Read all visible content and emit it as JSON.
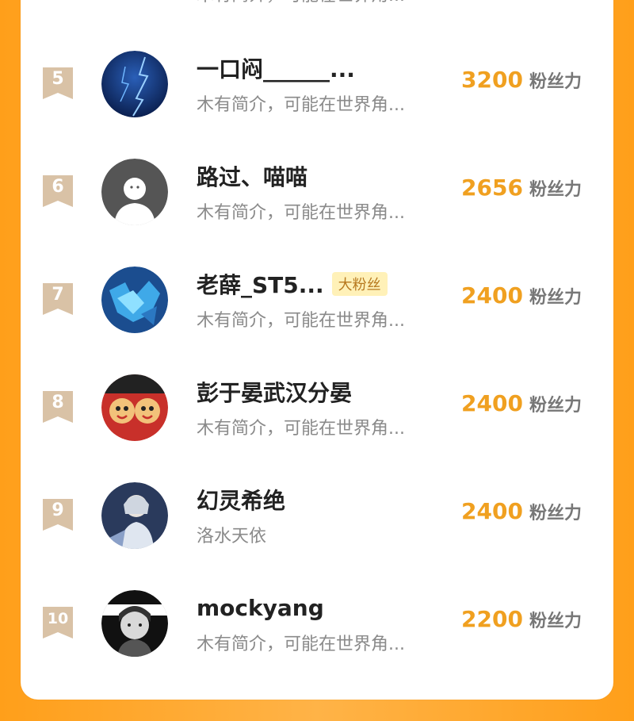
{
  "top_partial": {
    "intro": "木有简介，可能在世界角..."
  },
  "score_unit": "粉丝力",
  "rows": [
    {
      "rank": "5",
      "name": "一口闷______...",
      "intro": "木有简介，可能在世界角...",
      "score": "3200",
      "badge": ""
    },
    {
      "rank": "6",
      "name": "路过、喵喵",
      "intro": "木有简介，可能在世界角...",
      "score": "2656",
      "badge": ""
    },
    {
      "rank": "7",
      "name": "老薛_ST5...",
      "intro": "木有简介，可能在世界角...",
      "score": "2400",
      "badge": "大粉丝"
    },
    {
      "rank": "8",
      "name": "彭于晏武汉分晏",
      "intro": "木有简介，可能在世界角...",
      "score": "2400",
      "badge": ""
    },
    {
      "rank": "9",
      "name": "幻灵希绝",
      "intro": "洛水天依",
      "score": "2400",
      "badge": ""
    },
    {
      "rank": "10",
      "name": "mockyang",
      "intro": "木有简介，可能在世界角...",
      "score": "2200",
      "badge": ""
    }
  ],
  "colors": {
    "accent": "#f0a020",
    "rank_tag": "#d9c2a6",
    "background_orange": "#ff9f1a"
  }
}
